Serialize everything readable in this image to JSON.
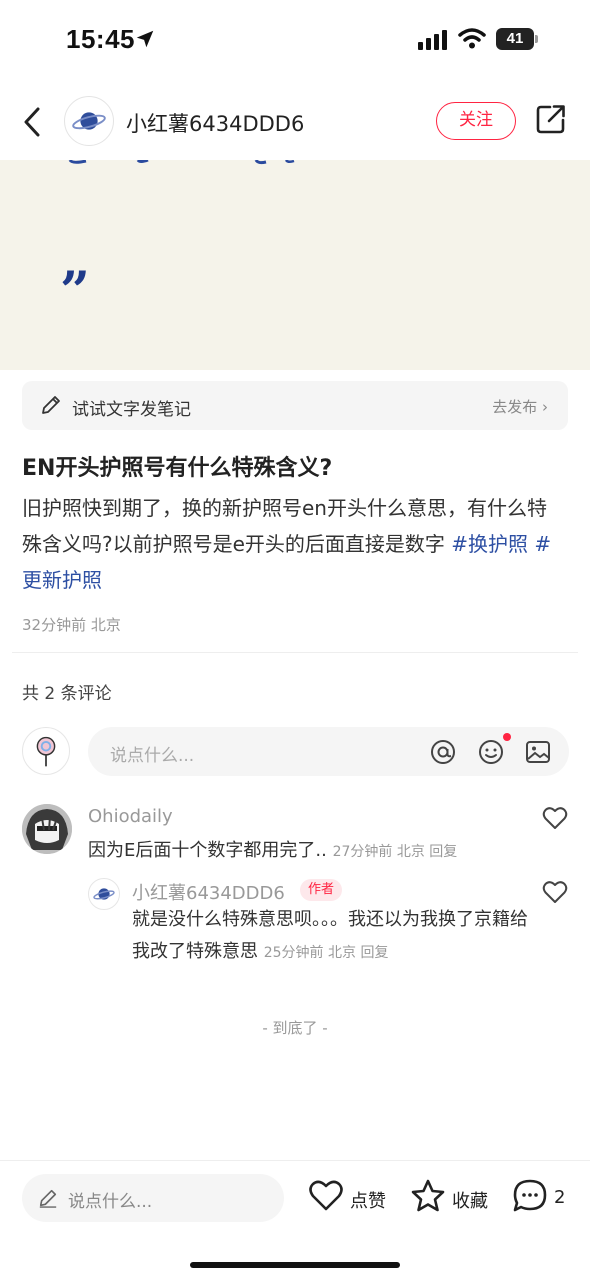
{
  "status_bar": {
    "time": "15:45",
    "battery": "41"
  },
  "header": {
    "username": "小红薯6434DDD6",
    "follow_label": "关注"
  },
  "try_note": {
    "label": "试试文字发笔记",
    "action": "去发布 ›"
  },
  "post": {
    "title": "EN开头护照号有什么特殊含义?",
    "body": "旧护照快到期了，换的新护照号en开头什么意思，有什么特殊含义吗?以前护照号是e开头的后面直接是数字",
    "tags": [
      "#换护照",
      "#更新护照"
    ],
    "meta": "32分钟前 北京"
  },
  "comments_section": {
    "count_label": "共 2 条评论",
    "input_placeholder": "说点什么...",
    "comments": [
      {
        "name": "Ohiodaily",
        "text": "因为E后面十个数字都用完了..",
        "meta": "27分钟前 北京 回复"
      }
    ],
    "reply": {
      "name": "小红薯6434DDD6",
      "badge": "作者",
      "text": "就是没什么特殊意思呗。。。我还以为我换了京籍给我改了特殊意思",
      "meta": "25分钟前 北京 回复"
    },
    "end_label": "- 到底了 -"
  },
  "bottom_bar": {
    "placeholder": "说点什么...",
    "like_label": "点赞",
    "collect_label": "收藏",
    "comment_count": "2"
  },
  "colors": {
    "accent": "#ff2442",
    "hashtag": "#2d4fa3",
    "image_bg": "#f5f3ea"
  },
  "icons": [
    "location-arrow-icon",
    "signal-icon",
    "wifi-icon",
    "battery-icon",
    "back-icon",
    "planet-icon",
    "share-icon",
    "pencil-icon",
    "at-icon",
    "emoji-icon",
    "image-icon",
    "heart-icon",
    "star-icon",
    "comment-icon",
    "chevron-right-icon"
  ]
}
